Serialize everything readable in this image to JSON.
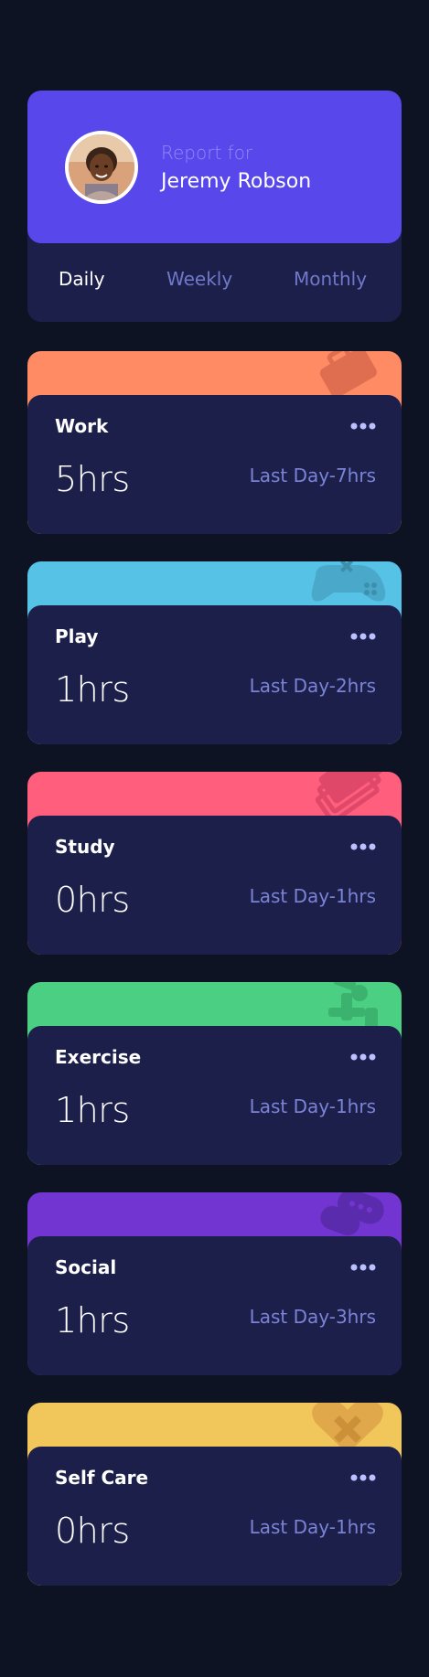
{
  "profile": {
    "report_label": "Report for",
    "name": "Jeremy Robson"
  },
  "tabs": [
    {
      "label": "Daily",
      "active": true
    },
    {
      "label": "Weekly",
      "active": false
    },
    {
      "label": "Monthly",
      "active": false
    }
  ],
  "activities": [
    {
      "title": "Work",
      "current": "5hrs",
      "previous": "Last Day-7hrs",
      "color": "#ff8b64",
      "icon": "briefcase-icon"
    },
    {
      "title": "Play",
      "current": "1hrs",
      "previous": "Last Day-2hrs",
      "color": "#55c2e6",
      "icon": "gamepad-icon"
    },
    {
      "title": "Study",
      "current": "0hrs",
      "previous": "Last Day-1hrs",
      "color": "#ff5e7d",
      "icon": "book-icon"
    },
    {
      "title": "Exercise",
      "current": "1hrs",
      "previous": "Last Day-1hrs",
      "color": "#4bcf82",
      "icon": "runner-icon"
    },
    {
      "title": "Social",
      "current": "1hrs",
      "previous": "Last Day-3hrs",
      "color": "#7335d2",
      "icon": "chat-icon"
    },
    {
      "title": "Self Care",
      "current": "0hrs",
      "previous": "Last Day-1hrs",
      "color": "#f1c75b",
      "icon": "heart-icon"
    }
  ]
}
